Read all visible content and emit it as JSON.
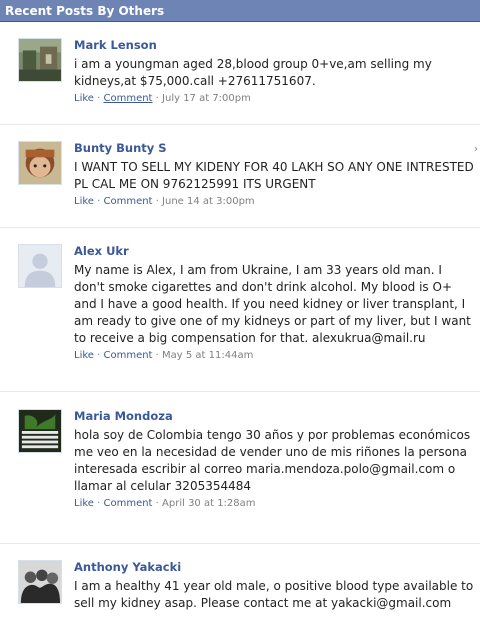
{
  "header": {
    "title": "Recent Posts By Others"
  },
  "posts": [
    {
      "author": "Mark Lenson",
      "text": "i am a youngman aged 28,blood group 0+ve,am selling my kidneys,at $75,000.call +27611751607.",
      "like": "Like",
      "dot1": " · ",
      "comment": "Comment",
      "dot2": " · ",
      "time": "July 17 at 7:00pm"
    },
    {
      "author": "Bunty Bunty S",
      "text": "I WANT TO SELL MY KIDENY FOR 40 LAKH SO ANY ONE INTRESTED PL CAL ME ON 9762125991 ITS URGENT",
      "like": "Like",
      "dot1": " · ",
      "comment": "Comment",
      "dot2": " · ",
      "time": "June 14 at 3:00pm"
    },
    {
      "author": "Alex Ukr",
      "text": "My name is Alex, I am from Ukraine, I am 33 years old man. I don't smoke cigarettes and don't drink alcohol. My blood is O+ and I have a good health. If you need kidney or liver transplant, I am ready to give one of my kidneys or part of my liver, but I want to receive a big compensation for that. alexukrua@mail.ru",
      "like": "Like",
      "dot1": " · ",
      "comment": "Comment",
      "dot2": " · ",
      "time": "May 5 at 11:44am"
    },
    {
      "author": "Maria Mondoza",
      "text": "hola soy de Colombia tengo 30 años y por problemas económicos me veo en la necesidad de vender uno de mis riñones la persona interesada escribir al correo maria.mendoza.polo@gmail.com o llamar al celular 3205354484",
      "like": "Like",
      "dot1": " · ",
      "comment": "Comment",
      "dot2": " · ",
      "time": "April 30 at 1:28am"
    },
    {
      "author": "Anthony Yakacki",
      "text": "I am a healthy 41 year old male, o positive blood type available to sell my kidney asap. Please contact me at yakacki@gmail.com"
    }
  ]
}
